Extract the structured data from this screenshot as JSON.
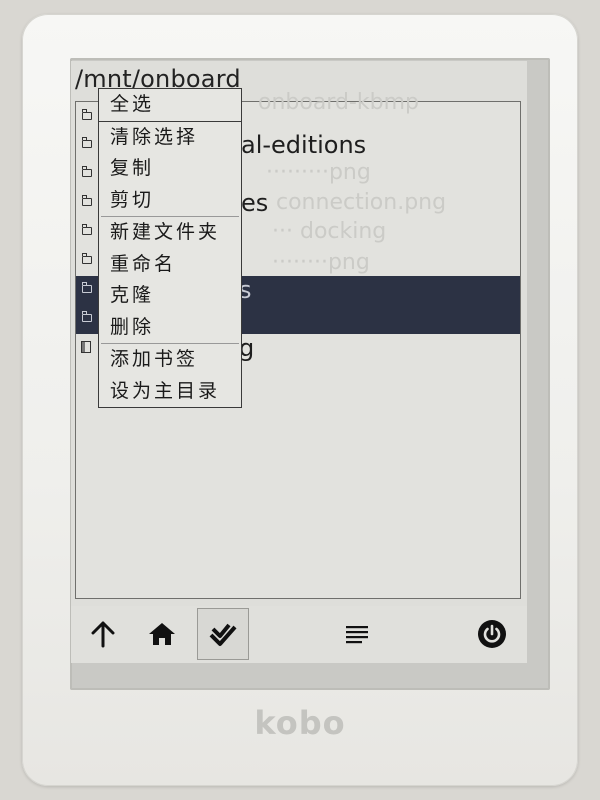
{
  "app": {
    "path": "/mnt/onboard",
    "brand": "kobo"
  },
  "files": [
    {
      "name": "",
      "type": "folder",
      "selected": false
    },
    {
      "name": "al-editions",
      "type": "folder",
      "selected": false
    },
    {
      "name": "",
      "type": "folder",
      "selected": false
    },
    {
      "name": "es",
      "type": "folder",
      "selected": false
    },
    {
      "name": "",
      "type": "folder",
      "selected": false
    },
    {
      "name": "",
      "type": "folder",
      "selected": false
    },
    {
      "name": "s",
      "type": "folder",
      "selected": true
    },
    {
      "name": "",
      "type": "folder",
      "selected": true
    },
    {
      "name": "g",
      "type": "file",
      "selected": false
    }
  ],
  "context_menu": {
    "items": [
      "全选",
      "清除选择",
      "复制",
      "剪切",
      "新建文件夹",
      "重命名",
      "克隆",
      "删除",
      "添加书签",
      "设为主目录"
    ]
  },
  "toolbar": {
    "buttons": [
      {
        "icon": "arrow-up-icon",
        "active": false
      },
      {
        "icon": "home-icon",
        "active": false
      },
      {
        "icon": "select-check-icon",
        "active": true
      },
      {
        "icon": "menu-lines-icon",
        "active": false
      },
      {
        "icon": "power-icon",
        "active": false
      }
    ]
  }
}
